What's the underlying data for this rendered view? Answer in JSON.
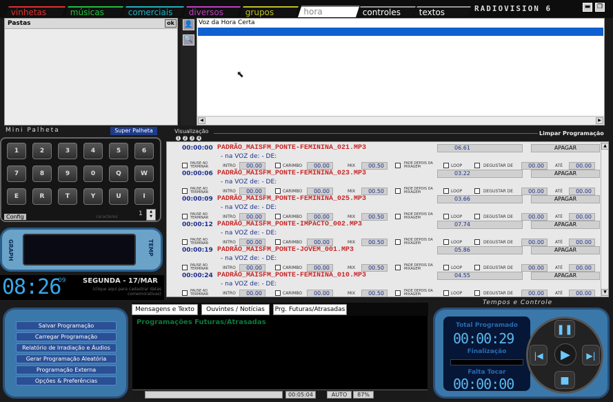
{
  "app": {
    "brand": "RADIOVISION 6"
  },
  "tabs": [
    {
      "label": "vinhetas",
      "color": "#e03030"
    },
    {
      "label": "músicas",
      "color": "#20c040"
    },
    {
      "label": "comerciais",
      "color": "#20b0c0"
    },
    {
      "label": "diversos",
      "color": "#c040c0"
    },
    {
      "label": "grupos",
      "color": "#c0c020"
    },
    {
      "label": "hora",
      "color": "#888888"
    },
    {
      "label": "controles",
      "color": "#ffffff"
    },
    {
      "label": "textos",
      "color": "#ffffff"
    }
  ],
  "folders": {
    "title": "Pastas",
    "ok": "ok"
  },
  "hour_panel": {
    "title": "Voz da Hora Certa"
  },
  "mini": {
    "label": "Mini Palheta",
    "super_button": "Super Palheta",
    "config": "Config",
    "page_hint": "caracteres",
    "page_value": "1"
  },
  "keypad": [
    "1",
    "2",
    "3",
    "4",
    "5",
    "6",
    "7",
    "8",
    "9",
    "0",
    "Q",
    "W",
    "E",
    "R",
    "T",
    "Y",
    "U",
    "I"
  ],
  "visual": {
    "label": "Visualização",
    "dots": [
      "1",
      "2",
      "3",
      "4"
    ],
    "clear": "Limpar Programação"
  },
  "graph": {
    "left": "GRAPH",
    "right": "TEMP"
  },
  "clock": {
    "time": "08:26",
    "seconds": "09",
    "date": "SEGUNDA - 17/MAR",
    "hint": "(clique aqui para cadastrar datas comemorativas)"
  },
  "playlist_labels": {
    "voz": "- na VOZ de:  -   DE:",
    "pause": "PAUSE AO TERMINAR",
    "intro": "INTRO",
    "carimbo": "CARIMBO",
    "mix": "MIX",
    "fade": "FADE DEPOIS DA MIXAGEM",
    "loop": "LOOP",
    "degustar": "DEGUSTAR DE",
    "ate": "ATÉ",
    "apagar": "APAGAR"
  },
  "playlist": [
    {
      "time": "00:00:00",
      "file": "PADRÃO_MAISFM_PONTE-FEMININA_021.MP3",
      "duration": "06.61",
      "intro": "00.00",
      "carimbo": "00.00",
      "mix": "00.50",
      "degustar": "00.00",
      "ate": "00.00"
    },
    {
      "time": "00:00:06",
      "file": "PADRÃO_MAISFM_PONTE-FEMININA_023.MP3",
      "duration": "03.22",
      "intro": "00.00",
      "carimbo": "00.00",
      "mix": "00.50",
      "degustar": "00.00",
      "ate": "00.00"
    },
    {
      "time": "00:00:09",
      "file": "PADRÃO_MAISFM_PONTE-FEMININA_025.MP3",
      "duration": "03.66",
      "intro": "00.00",
      "carimbo": "00.00",
      "mix": "00.50",
      "degustar": "00.00",
      "ate": "00.00"
    },
    {
      "time": "00:00:12",
      "file": "PADRÃO_MAISFM_PONTE-IMPACTO_002.MP3",
      "duration": "07.74",
      "intro": "00.00",
      "carimbo": "00.00",
      "mix": "00.50",
      "degustar": "00.00",
      "ate": "00.00"
    },
    {
      "time": "00:00:19",
      "file": "PADRÃO_MAISFM_PONTE-JOVEM_001.MP3",
      "duration": "05.86",
      "intro": "00.00",
      "carimbo": "00.00",
      "mix": "00.50",
      "degustar": "00.00",
      "ate": "00.00"
    },
    {
      "time": "00:00:24",
      "file": "PADRÃO_MAISFM_PONTE-FEMININA_010.MP3",
      "duration": "04.55",
      "intro": "00.00",
      "carimbo": "00.00",
      "mix": "00.50",
      "degustar": "00.00",
      "ate": "00.00"
    }
  ],
  "menu": [
    "Salvar Programação",
    "Carregar Programação",
    "Relatório de Irradiação e Áudios",
    "Gerar Programação Aleatória",
    "Programação Externa",
    "Opções & Preferências"
  ],
  "messages": {
    "tabs": [
      "Mensagens e Texto",
      "Ouvintes / Notícias",
      "Prg. Futuras/Atrasadas"
    ],
    "title": "Programações Futuras/Atrasadas"
  },
  "status": {
    "time": "00:05:04",
    "mode": "AUTO",
    "percent": "87%"
  },
  "time_control": {
    "title": "Tempos e Controle",
    "total_label": "Total Programado",
    "total": "00:00:29",
    "finish_label": "Finalização",
    "remaining_label": "Falta Tocar",
    "remaining": "00:00:00"
  },
  "colors": {
    "accent": "#1e3b8a",
    "file_red": "#c82828",
    "panel_blue": "#3a78aa",
    "digits": "#3aa6e8"
  }
}
